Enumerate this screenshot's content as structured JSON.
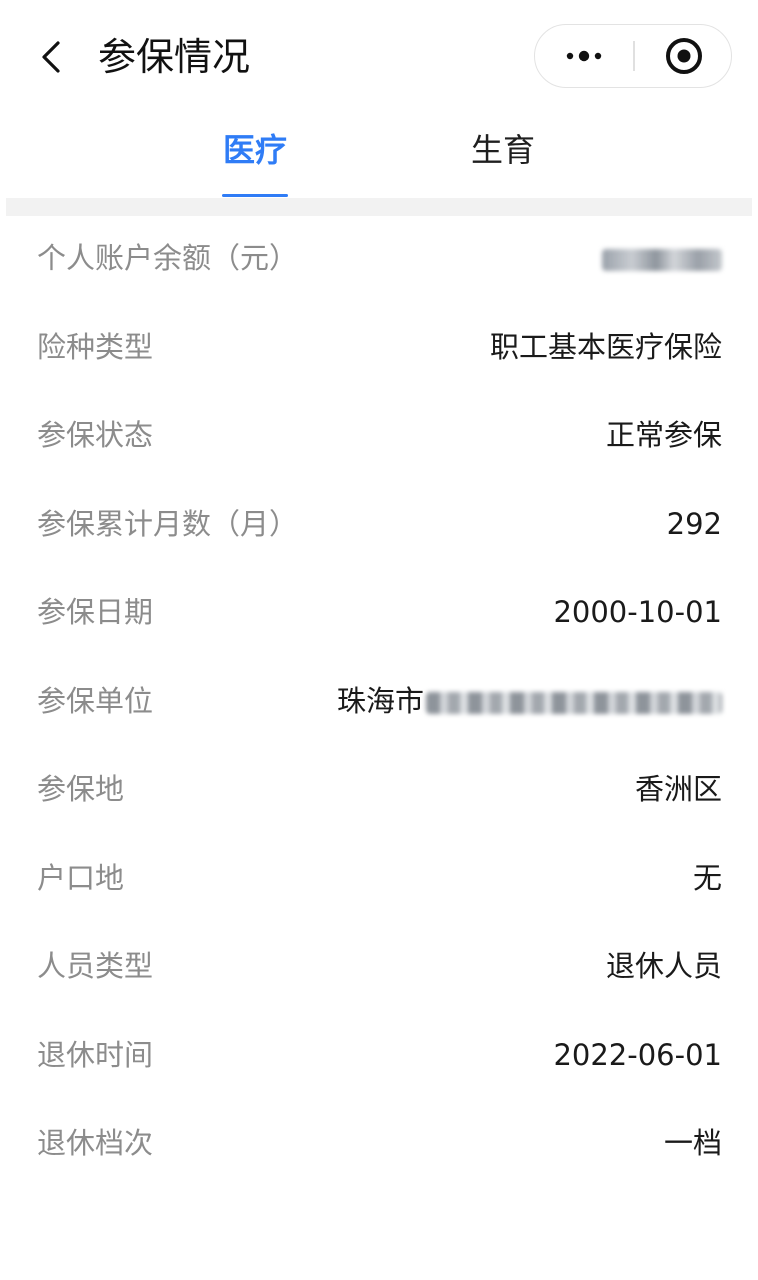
{
  "header": {
    "title": "参保情况",
    "back_icon": "back-chevron-icon",
    "more_icon": "more-dots-icon",
    "close_icon": "close-target-icon"
  },
  "tabs": [
    {
      "label": "医疗",
      "active": true
    },
    {
      "label": "生育",
      "active": false
    }
  ],
  "colors": {
    "accent": "#2f7cf6",
    "label": "#8c8c8c",
    "value": "#1a1a1a",
    "separator": "#f2f2f2"
  },
  "rows": [
    {
      "label": "个人账户余额（元）",
      "value": "",
      "redacted": true
    },
    {
      "label": "险种类型",
      "value": "职工基本医疗保险"
    },
    {
      "label": "参保状态",
      "value": "正常参保"
    },
    {
      "label": "参保累计月数（月）",
      "value": "292"
    },
    {
      "label": "参保日期",
      "value": "2000-10-01"
    },
    {
      "label": "参保单位",
      "value": "珠海市",
      "redacted": true
    },
    {
      "label": "参保地",
      "value": "香洲区"
    },
    {
      "label": "户口地",
      "value": "无"
    },
    {
      "label": "人员类型",
      "value": "退休人员"
    },
    {
      "label": "退休时间",
      "value": "2022-06-01"
    },
    {
      "label": "退休档次",
      "value": "一档"
    }
  ]
}
